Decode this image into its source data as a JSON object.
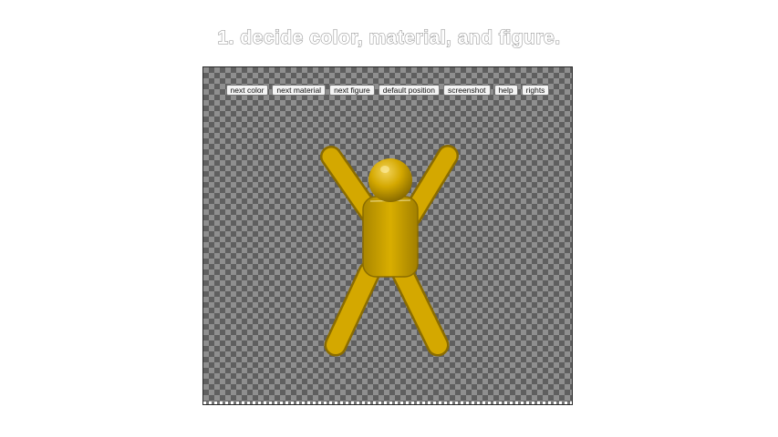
{
  "page": {
    "title": "1. decide color, material, and figure."
  },
  "viewer": {
    "toolbar": {
      "buttons": [
        {
          "label": "next color"
        },
        {
          "label": "next material"
        },
        {
          "label": "next figure"
        },
        {
          "label": "default position"
        },
        {
          "label": "screenshot"
        },
        {
          "label": "help"
        },
        {
          "label": "rights"
        }
      ]
    },
    "figure": {
      "color": "#d4a800",
      "shade": "#8a6c00",
      "highlight": "#f2d35a"
    },
    "background": {
      "checker_light": "#8f8f8f",
      "checker_dark": "#5f5f5f"
    }
  }
}
